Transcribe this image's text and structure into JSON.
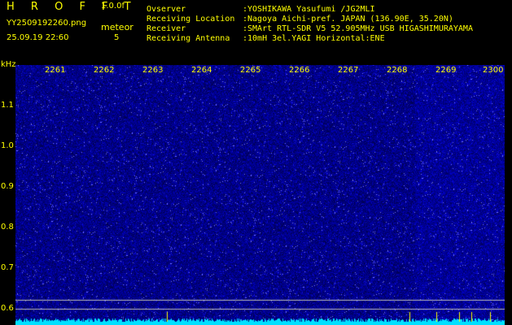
{
  "header": {
    "brand": "H R O F F T",
    "version": "1.0.0f",
    "filename": "YY2509192260.png",
    "datetime": "25.09.19 22:60",
    "meteor_label": "meteor",
    "meteor_count": "5",
    "info": [
      {
        "label": "Ovserver",
        "value": ":YOSHIKAWA Yasufumi /JG2MLI"
      },
      {
        "label": "Receiving Location",
        "value": ":Nagoya Aichi-pref. JAPAN (136.90E, 35.20N)"
      },
      {
        "label": "Receiver",
        "value": ":SMArt RTL-SDR V5 52.905MHz USB HIGASHIMURAYAMA"
      },
      {
        "label": "Receiving Antenna",
        "value": ":10mH 3el.YAGI Horizontal:ENE"
      }
    ]
  },
  "axis": {
    "unit": "kHz",
    "y_ticks": [
      "1.1",
      "1.0",
      "0.9",
      "0.8",
      "0.7",
      "0.6"
    ],
    "x_ticks": [
      "2261",
      "2262",
      "2263",
      "2264",
      "2265",
      "2266",
      "2267",
      "2268",
      "2269",
      "2300"
    ]
  },
  "colors": {
    "text": "#ffff00",
    "background": "#000000",
    "spectrum_base": "#00008a",
    "noise_band": "#00ffff"
  }
}
